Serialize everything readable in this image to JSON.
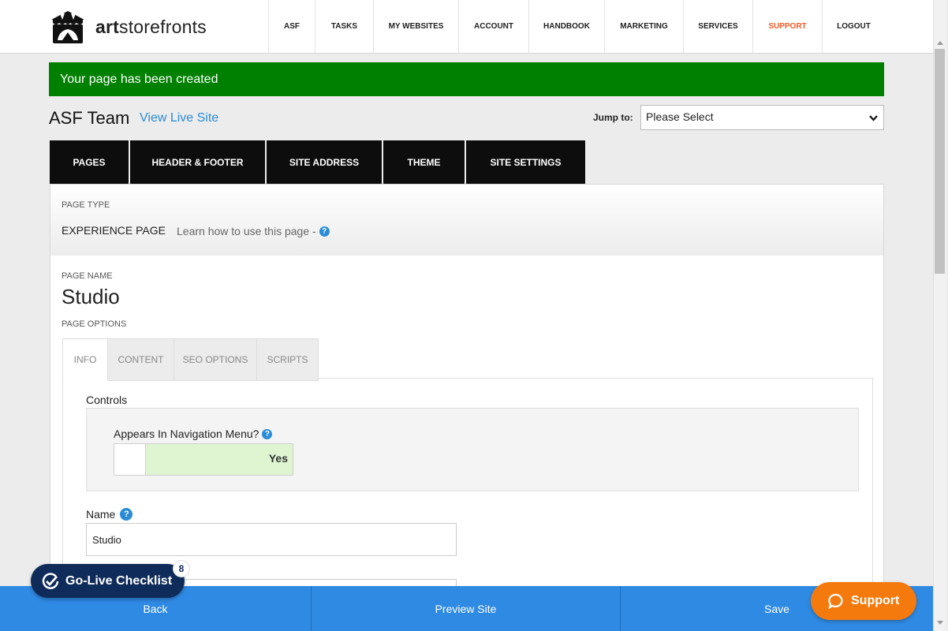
{
  "header": {
    "logo_text_bold": "art",
    "logo_text_rest": "storefronts",
    "nav": [
      {
        "label": "ASF"
      },
      {
        "label": "TASKS"
      },
      {
        "label": "MY WEBSITES"
      },
      {
        "label": "ACCOUNT"
      },
      {
        "label": "HANDBOOK"
      },
      {
        "label": "MARKETING"
      },
      {
        "label": "SERVICES"
      },
      {
        "label": "SUPPORT"
      },
      {
        "label": "LOGOUT"
      }
    ]
  },
  "alert": {
    "message": "Your page has been created",
    "color": "#008000"
  },
  "site": {
    "name": "ASF Team",
    "live_link": "View Live Site",
    "jump_label": "Jump to:",
    "jump_value": "Please Select"
  },
  "main_tabs": [
    {
      "label": "PAGES"
    },
    {
      "label": "HEADER & FOOTER"
    },
    {
      "label": "SITE ADDRESS"
    },
    {
      "label": "THEME"
    },
    {
      "label": "SITE SETTINGS"
    }
  ],
  "page": {
    "type_label": "PAGE TYPE",
    "type_value": "EXPERIENCE PAGE",
    "learn_text": "Learn how to use this page -",
    "name_label": "PAGE NAME",
    "name_value": "Studio",
    "options_label": "PAGE OPTIONS"
  },
  "sub_tabs": [
    {
      "label": "INFO"
    },
    {
      "label": "CONTENT"
    },
    {
      "label": "SEO OPTIONS"
    },
    {
      "label": "SCRIPTS"
    }
  ],
  "form": {
    "controls_title": "Controls",
    "nav_question": "Appears In Navigation Menu?",
    "nav_toggle": "Yes",
    "name_label": "Name",
    "name_value": "Studio"
  },
  "bottom": {
    "back": "Back",
    "preview": "Preview Site",
    "save": "Save"
  },
  "checklist": {
    "label": "Go-Live Checklist",
    "count": "8"
  },
  "support_pill": {
    "label": "Support"
  },
  "colors": {
    "accent_blue": "#2f8ae3",
    "link_blue": "#2a8cd6",
    "support_orange": "#f47a0e",
    "nav_support": "#f05a28",
    "checklist_navy": "#0f2b59"
  }
}
